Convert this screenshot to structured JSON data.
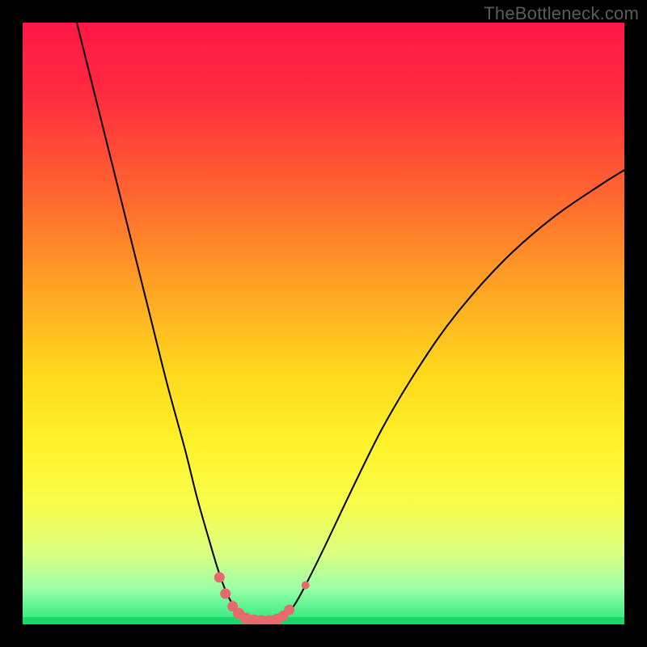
{
  "watermark": "TheBottleneck.com",
  "chart_data": {
    "type": "line",
    "title": "",
    "xlabel": "",
    "ylabel": "",
    "xlim": [
      0,
      100
    ],
    "ylim": [
      0,
      100
    ],
    "background": {
      "gradient_stops": [
        {
          "offset": 0.0,
          "color": "#ff1846"
        },
        {
          "offset": 0.12,
          "color": "#ff2b3f"
        },
        {
          "offset": 0.28,
          "color": "#ff6430"
        },
        {
          "offset": 0.44,
          "color": "#ffa324"
        },
        {
          "offset": 0.58,
          "color": "#ffd81c"
        },
        {
          "offset": 0.7,
          "color": "#fff22a"
        },
        {
          "offset": 0.8,
          "color": "#f8fc4a"
        },
        {
          "offset": 0.88,
          "color": "#dcff81"
        },
        {
          "offset": 0.94,
          "color": "#9bffa8"
        },
        {
          "offset": 1.0,
          "color": "#24e77a"
        }
      ]
    },
    "series": [
      {
        "name": "bottleneck-curve",
        "stroke": "#000000",
        "stroke_width": 2,
        "data": [
          {
            "x": 9.0,
            "y": 100.0
          },
          {
            "x": 10.0,
            "y": 96.0
          },
          {
            "x": 12.0,
            "y": 88.0
          },
          {
            "x": 15.0,
            "y": 76.0
          },
          {
            "x": 18.0,
            "y": 64.0
          },
          {
            "x": 21.0,
            "y": 52.0
          },
          {
            "x": 24.0,
            "y": 40.0
          },
          {
            "x": 27.0,
            "y": 29.0
          },
          {
            "x": 29.0,
            "y": 21.0
          },
          {
            "x": 31.0,
            "y": 14.0
          },
          {
            "x": 32.5,
            "y": 9.0
          },
          {
            "x": 34.0,
            "y": 5.0
          },
          {
            "x": 35.5,
            "y": 2.5
          },
          {
            "x": 37.0,
            "y": 1.2
          },
          {
            "x": 39.0,
            "y": 0.6
          },
          {
            "x": 41.0,
            "y": 0.6
          },
          {
            "x": 43.0,
            "y": 1.2
          },
          {
            "x": 45.0,
            "y": 3.0
          },
          {
            "x": 47.0,
            "y": 6.5
          },
          {
            "x": 50.0,
            "y": 12.5
          },
          {
            "x": 55.0,
            "y": 23.0
          },
          {
            "x": 60.0,
            "y": 33.0
          },
          {
            "x": 66.0,
            "y": 43.0
          },
          {
            "x": 72.0,
            "y": 51.5
          },
          {
            "x": 80.0,
            "y": 60.5
          },
          {
            "x": 88.0,
            "y": 67.5
          },
          {
            "x": 96.0,
            "y": 73.0
          },
          {
            "x": 100.0,
            "y": 75.5
          }
        ]
      }
    ],
    "markers": {
      "name": "highlight-dots",
      "color": "#e46a6e",
      "points": [
        {
          "x": 32.7,
          "y": 7.8,
          "r": 6.5
        },
        {
          "x": 33.7,
          "y": 5.1,
          "r": 6.5
        },
        {
          "x": 34.9,
          "y": 3.0,
          "r": 6.5
        },
        {
          "x": 35.9,
          "y": 1.8,
          "r": 7.0
        },
        {
          "x": 37.1,
          "y": 1.0,
          "r": 7.0
        },
        {
          "x": 38.4,
          "y": 0.7,
          "r": 7.0
        },
        {
          "x": 39.7,
          "y": 0.6,
          "r": 7.0
        },
        {
          "x": 41.0,
          "y": 0.6,
          "r": 7.0
        },
        {
          "x": 42.2,
          "y": 0.8,
          "r": 7.0
        },
        {
          "x": 43.3,
          "y": 1.4,
          "r": 6.5
        },
        {
          "x": 44.3,
          "y": 2.4,
          "r": 6.5
        },
        {
          "x": 47.0,
          "y": 6.5,
          "r": 5.0
        }
      ]
    },
    "bottom_band": {
      "name": "bottom-green-band",
      "color": "#18d768",
      "y": 0,
      "height_pct": 1.2
    }
  }
}
